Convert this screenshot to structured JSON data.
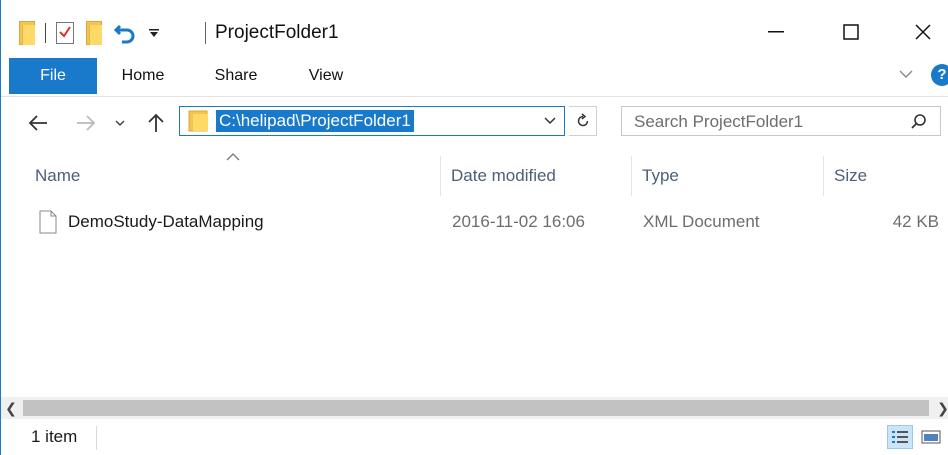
{
  "window": {
    "title": "ProjectFolder1",
    "controls": {
      "minimize": "—",
      "maximize": "☐",
      "close": "✕"
    }
  },
  "ribbon": {
    "tabs": [
      "File",
      "Home",
      "Share",
      "View"
    ],
    "help": "?"
  },
  "address": {
    "path": "C:\\helipad\\ProjectFolder1"
  },
  "search": {
    "placeholder": "Search ProjectFolder1"
  },
  "columns": [
    "Name",
    "Date modified",
    "Type",
    "Size"
  ],
  "files": [
    {
      "name": "DemoStudy-DataMapping",
      "date": "2016-11-02 16:06",
      "type": "XML Document",
      "size": "42 KB"
    }
  ],
  "status": {
    "item_count": "1 item"
  },
  "colors": {
    "accent": "#1979ca",
    "header_text": "#4c607a",
    "folder": "#ffd965"
  }
}
